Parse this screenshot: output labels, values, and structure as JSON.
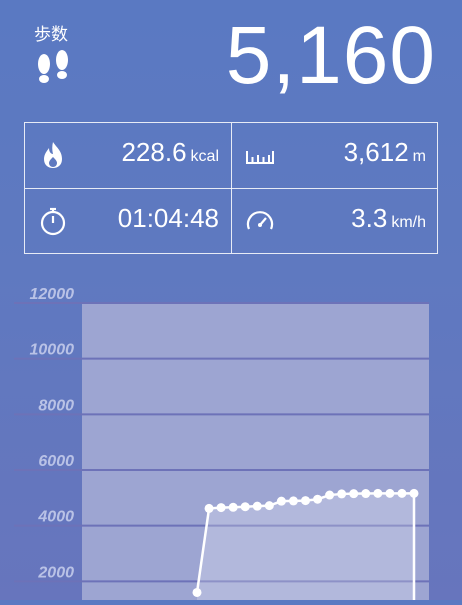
{
  "header": {
    "steps_label": "歩数",
    "steps_value": "5,160",
    "icon": "footsteps-icon"
  },
  "stats": {
    "calories": {
      "value": "228.6",
      "unit": "kcal",
      "icon": "flame-icon"
    },
    "distance": {
      "value": "3,612",
      "unit": "m",
      "icon": "ruler-icon"
    },
    "duration": {
      "value": "01:04:48",
      "icon": "stopwatch-icon"
    },
    "speed": {
      "value": "3.3",
      "unit": "km/h",
      "icon": "speedometer-icon"
    }
  },
  "colors": {
    "background_top": "#5a79c2",
    "background_bottom": "#6775bd",
    "plot_fill": "#9da5d2",
    "grid": "#6d72b8",
    "axis_label": "#b9c2e6"
  },
  "chart_data": {
    "type": "area",
    "title": "",
    "xlabel": "",
    "ylabel": "",
    "ylim": [
      0,
      12000
    ],
    "y_ticks": [
      "12000",
      "10000",
      "8000",
      "6000",
      "4000",
      "2000"
    ],
    "x": [
      1,
      2,
      3,
      4,
      5,
      6,
      7,
      8,
      9,
      10,
      11,
      12,
      13,
      14,
      15,
      16,
      17,
      18,
      19
    ],
    "series": [
      {
        "values": [
          1600,
          4620,
          4650,
          4660,
          4680,
          4700,
          4720,
          4880,
          4890,
          4900,
          4950,
          5100,
          5140,
          5150,
          5155,
          5160,
          5160,
          5160,
          5160
        ]
      }
    ],
    "grid": true
  }
}
